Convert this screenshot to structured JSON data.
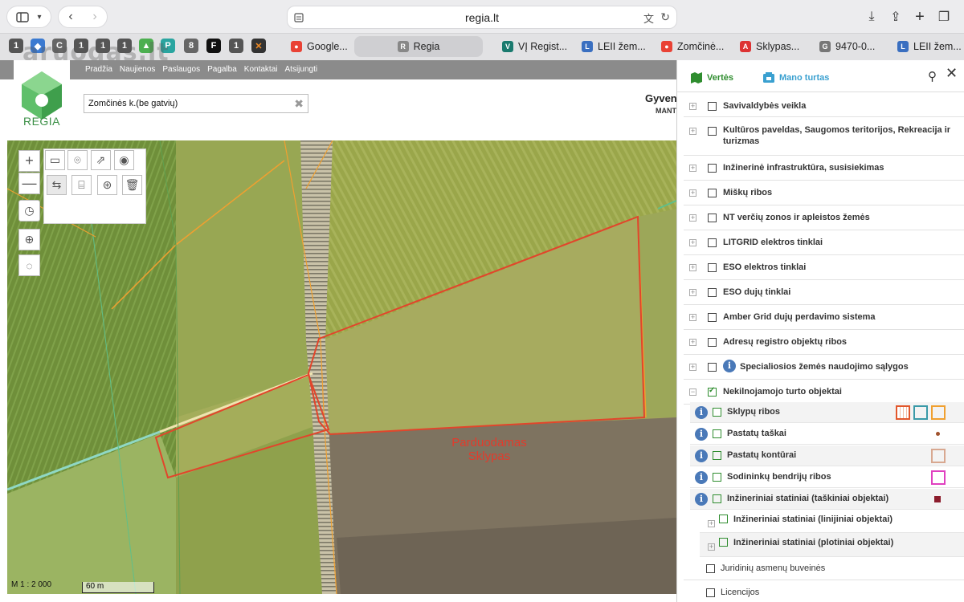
{
  "browser": {
    "url": "regia.lt",
    "pinned_tabs": [
      "1",
      "",
      "C",
      "1",
      "1",
      "1",
      "",
      "",
      "8",
      "F",
      "1",
      ""
    ],
    "tabs": [
      {
        "label": "Google...",
        "favicon": "map-pin-icon"
      },
      {
        "label": "Regia",
        "favicon": "R",
        "active": true
      },
      {
        "label": "VĮ Regist...",
        "favicon": "registry-icon"
      },
      {
        "label": "LEII žem...",
        "favicon": "leii-icon"
      },
      {
        "label": "Zomčinė...",
        "favicon": "map-pin-icon"
      },
      {
        "label": "Sklypas...",
        "favicon": "listing-icon"
      },
      {
        "label": "9470-0...",
        "favicon": "G"
      },
      {
        "label": "LEII žem...",
        "favicon": "leii-icon"
      }
    ],
    "watermark": "aruodas.lt"
  },
  "site": {
    "logo_text": "REGIA",
    "nav": [
      "Pradžia",
      "Naujienos",
      "Paslaugos",
      "Pagalba",
      "Kontaktai",
      "Atsijungti"
    ],
    "search_value": "Zomčinės k.(be gatvių)",
    "header_cut": "Gyven",
    "header_sub_cut": "MANT"
  },
  "map": {
    "label_line1": "Parduodamas",
    "label_line2": "Sklypas",
    "scale_text": "M 1 : 2 000",
    "scalebar_text": "60 m"
  },
  "panel": {
    "tab_values": "Vertės",
    "tab_property": "Mano turtas",
    "layers": [
      {
        "label": "Savivaldybės veikla",
        "checked": false
      },
      {
        "label": "Kultūros paveldas, Saugomos teritorijos, Rekreacija ir turizmas",
        "checked": false
      },
      {
        "label": "Inžinerinė infrastruktūra, susisiekimas",
        "checked": false
      },
      {
        "label": "Miškų ribos",
        "checked": false
      },
      {
        "label": "NT verčių zonos ir apleistos žemės",
        "checked": false
      },
      {
        "label": "LITGRID elektros tinklai",
        "checked": false
      },
      {
        "label": "ESO elektros tinklai",
        "checked": false
      },
      {
        "label": "ESO dujų tinklai",
        "checked": false
      },
      {
        "label": "Amber Grid dujų perdavimo sistema",
        "checked": false
      },
      {
        "label": "Adresų registro objektų ribos",
        "checked": false
      },
      {
        "label": "Specialiosios žemės naudojimo sąlygos",
        "checked": false
      },
      {
        "label": "Nekilnojamojo turto objektai",
        "checked": true
      }
    ],
    "sublayers": [
      {
        "label": "Sklypų ribos",
        "checked": true
      },
      {
        "label": "Pastatų taškai",
        "checked": true
      },
      {
        "label": "Pastatų kontūrai",
        "checked": true
      },
      {
        "label": "Sodininkų bendrijų ribos",
        "checked": true
      },
      {
        "label": "Inžineriniai statiniai (taškiniai objektai)",
        "checked": true
      },
      {
        "label": "Inžineriniai statiniai (linijiniai objektai)",
        "checked": true
      },
      {
        "label": "Inžineriniai statiniai (plotiniai objektai)",
        "checked": true
      }
    ],
    "bottom_layers": [
      "Juridinių asmenų buveinės",
      "Licencijos"
    ],
    "colors": {
      "accent_green": "#2f8d2f",
      "accent_blue": "#3aa0d0",
      "parcel": "#e2572b",
      "building_point": "#a0522d",
      "building_outline": "#d8a890",
      "garden": "#e040c0",
      "point_objects": "#8b1c2c"
    }
  }
}
